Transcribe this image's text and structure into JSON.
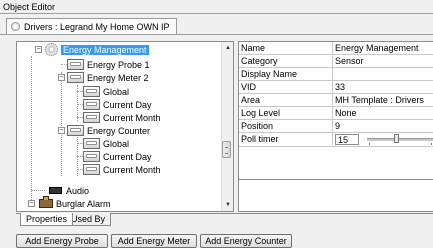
{
  "window": {
    "title": "Object Editor"
  },
  "drivers_tab": {
    "label": "Drivers : Legrand My Home OWN IP"
  },
  "tree": {
    "nodes": [
      {
        "label": "Energy Management",
        "selected": true
      },
      {
        "label": "Energy Probe 1"
      },
      {
        "label": "Energy Meter 2"
      },
      {
        "label": "Global"
      },
      {
        "label": "Current Day"
      },
      {
        "label": "Current Month"
      },
      {
        "label": "Energy Counter"
      },
      {
        "label": "Global"
      },
      {
        "label": "Current Day"
      },
      {
        "label": "Current Month"
      },
      {
        "label": "Audio"
      },
      {
        "label": "Burglar Alarm"
      }
    ],
    "expander_symbol": "−"
  },
  "properties": {
    "rows": [
      {
        "key": "Name",
        "value": "Energy Management"
      },
      {
        "key": "Category",
        "value": "Sensor"
      },
      {
        "key": "Display Name",
        "value": ""
      },
      {
        "key": "VID",
        "value": "33"
      },
      {
        "key": "Area",
        "value": "MH Template : Drivers"
      },
      {
        "key": "Log Level",
        "value": "None"
      },
      {
        "key": "Position",
        "value": "9"
      },
      {
        "key": "Poll timer",
        "value": "15"
      }
    ]
  },
  "bottom_tabs": {
    "properties": "Properties",
    "used_by": "Used By"
  },
  "buttons": {
    "add_probe": "Add Energy Probe",
    "add_meter": "Add Energy Meter",
    "add_counter": "Add Energy Counter"
  },
  "colors": {
    "selection": "#3399ff"
  }
}
